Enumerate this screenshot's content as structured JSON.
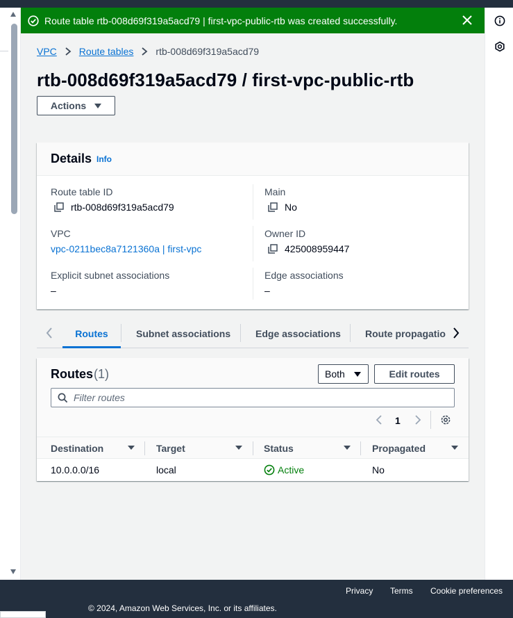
{
  "flash": {
    "message": "Route table rtb-008d69f319a5acd79 | first-vpc-public-rtb was created successfully.",
    "color": "#037f0c"
  },
  "breadcrumb": {
    "items": [
      "VPC",
      "Route tables"
    ],
    "current": "rtb-008d69f319a5acd79"
  },
  "page": {
    "title": "rtb-008d69f319a5acd79 / first-vpc-public-rtb",
    "actions_label": "Actions"
  },
  "details": {
    "title": "Details",
    "info": "Info",
    "route_table_id_label": "Route table ID",
    "route_table_id": "rtb-008d69f319a5acd79",
    "main_label": "Main",
    "main": "No",
    "vpc_label": "VPC",
    "vpc": "vpc-0211bec8a7121360a | first-vpc",
    "owner_id_label": "Owner ID",
    "owner_id": "425008959447",
    "explicit_label": "Explicit subnet associations",
    "explicit": "–",
    "edge_label": "Edge associations",
    "edge": "–"
  },
  "tabs": [
    {
      "label": "Routes",
      "active": true
    },
    {
      "label": "Subnet associations",
      "active": false
    },
    {
      "label": "Edge associations",
      "active": false
    },
    {
      "label": "Route propagatio",
      "active": false
    }
  ],
  "routes": {
    "title": "Routes",
    "count": "(1)",
    "select_value": "Both",
    "edit_label": "Edit routes",
    "filter_placeholder": "Filter routes",
    "page": "1",
    "columns": [
      "Destination",
      "Target",
      "Status",
      "Propagated"
    ],
    "rows": [
      {
        "destination": "10.0.0.0/16",
        "target": "local",
        "status": "Active",
        "propagated": "No"
      }
    ]
  },
  "footer": {
    "privacy": "Privacy",
    "terms": "Terms",
    "cookies": "Cookie preferences",
    "copyright": "© 2024, Amazon Web Services, Inc. or its affiliates."
  },
  "icons": {
    "success": "check-circle-icon",
    "close": "close-icon",
    "info_rail": "info-circle-icon",
    "feedback_rail": "hexagon-icon",
    "copy": "copy-icon",
    "search": "search-icon",
    "settings": "gear-icon"
  },
  "colors": {
    "link": "#0972d3",
    "success": "#037f0c",
    "footer_bg": "#232f3e"
  }
}
